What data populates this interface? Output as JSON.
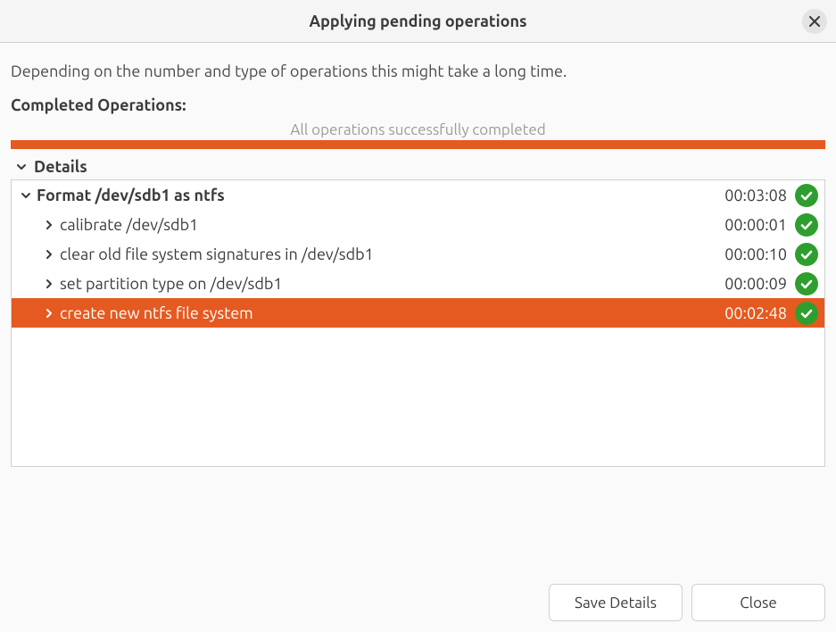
{
  "dialog": {
    "title": "Applying pending operations",
    "intro_text": "Depending on the number and type of operations this might take a long time.",
    "completed_heading": "Completed Operations:",
    "status_message": "All operations successfully completed",
    "progress_color": "#e55a20",
    "details_label": "Details",
    "details_expanded": true,
    "tree": [
      {
        "label": "Format /dev/sdb1 as ntfs",
        "duration": "00:03:08",
        "expanded": true,
        "bold": true,
        "selected": false,
        "status": "success",
        "children": [
          {
            "label": "calibrate /dev/sdb1",
            "duration": "00:00:01",
            "expanded": false,
            "bold": false,
            "selected": false,
            "status": "success"
          },
          {
            "label": "clear old file system signatures in /dev/sdb1",
            "duration": "00:00:10",
            "expanded": false,
            "bold": false,
            "selected": false,
            "status": "success"
          },
          {
            "label": "set partition type on /dev/sdb1",
            "duration": "00:00:09",
            "expanded": false,
            "bold": false,
            "selected": false,
            "status": "success"
          },
          {
            "label": "create new ntfs file system",
            "duration": "00:02:48",
            "expanded": false,
            "bold": false,
            "selected": true,
            "status": "success"
          }
        ]
      }
    ],
    "buttons": {
      "save_details": "Save Details",
      "close": "Close"
    }
  }
}
